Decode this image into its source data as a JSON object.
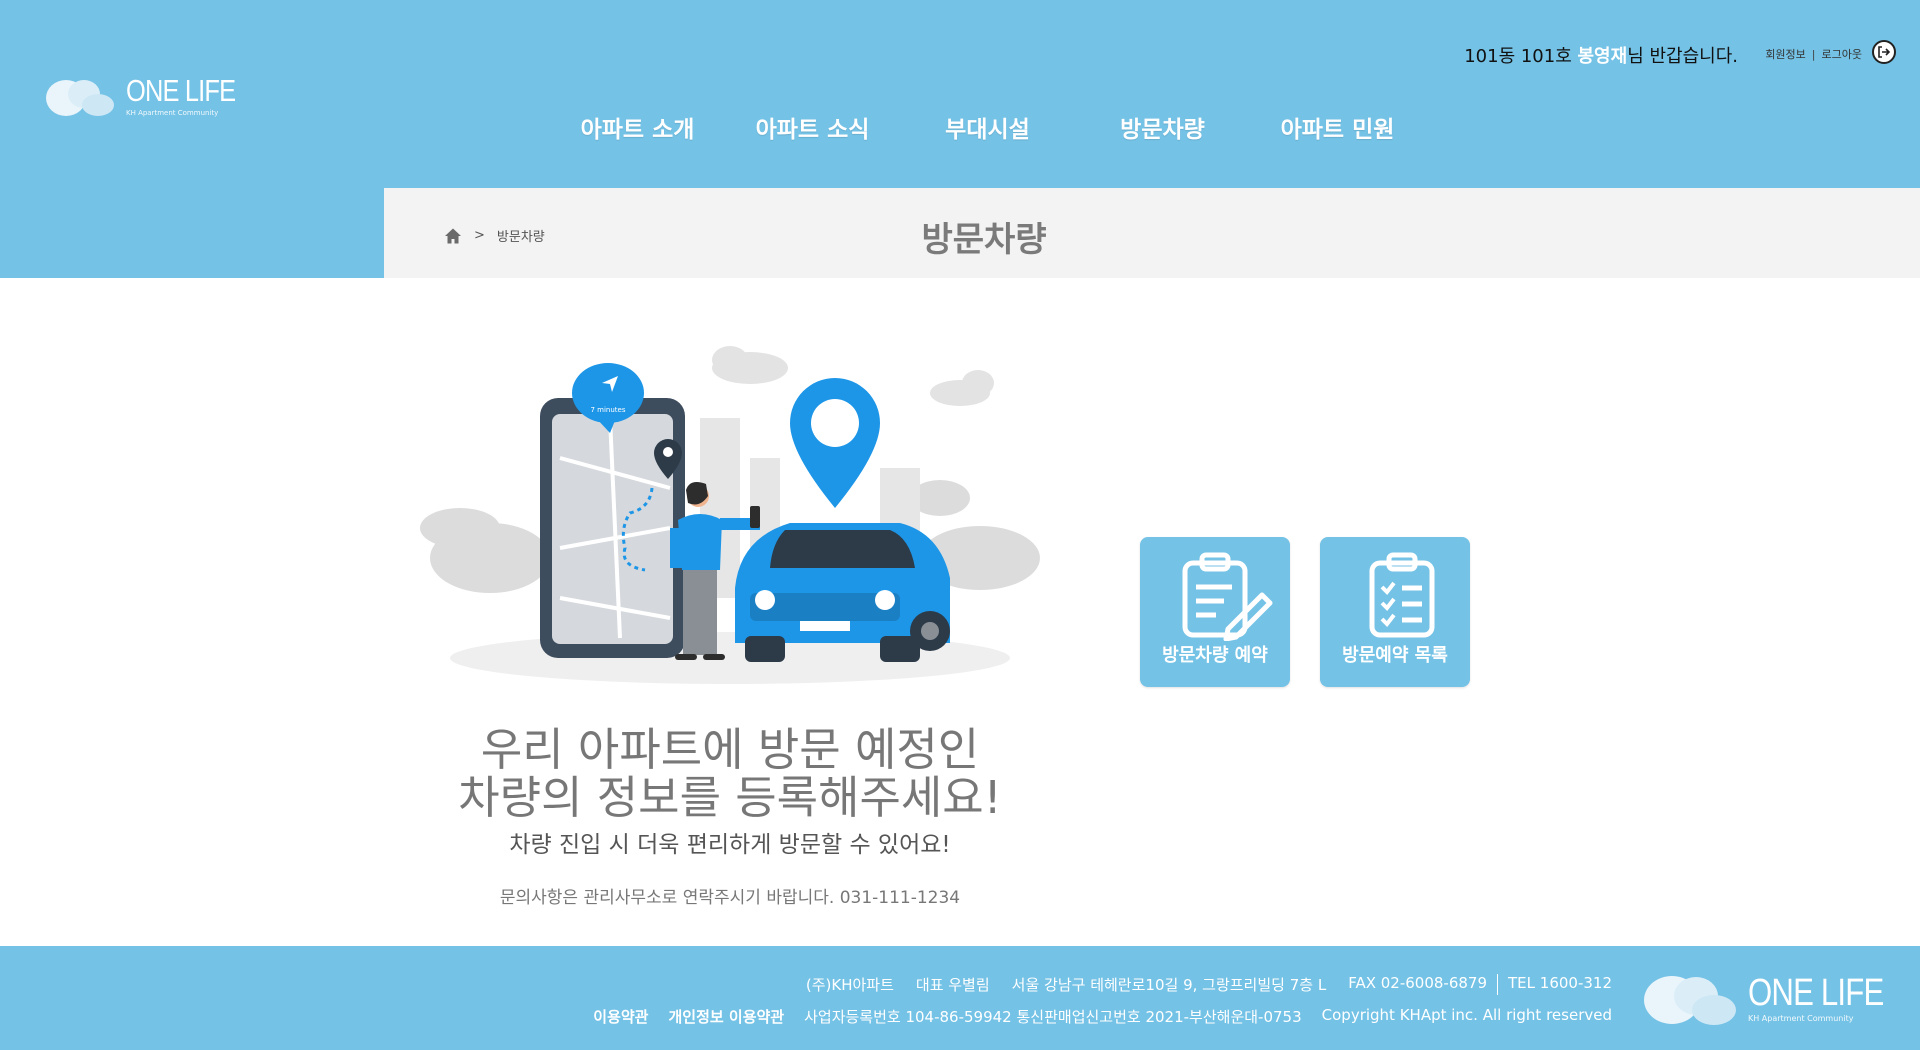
{
  "brand": {
    "name": "ONE LIFE",
    "tagline": "KH Apartment Community"
  },
  "header": {
    "greeting_prefix": "101동 101호 ",
    "greeting_name": "봉영재",
    "greeting_suffix": "님 반갑습니다.",
    "member_info": "회원정보",
    "logout": "로그아웃"
  },
  "nav": {
    "items": [
      {
        "label": "아파트 소개"
      },
      {
        "label": "아파트 소식"
      },
      {
        "label": "부대시설"
      },
      {
        "label": "방문차량"
      },
      {
        "label": "아파트 민원"
      }
    ]
  },
  "breadcrumb": {
    "separator": ">",
    "current": "방문차량"
  },
  "page": {
    "title": "방문차량",
    "headline_line1": "우리 아파트에 방문 예정인",
    "headline_line2": "차량의 정보를 등록해주세요!",
    "subline": "차량 진입 시 더욱 편리하게 방문할 수 있어요!",
    "contact": "문의사항은 관리사무소로 연락주시기 바랍니다. 031-111-1234"
  },
  "illustration": {
    "bubble_text": "7 minutes"
  },
  "actions": {
    "reserve": "방문차량 예약",
    "list": "방문예약 목록"
  },
  "footer": {
    "company": "(주)KH아파트",
    "ceo": "대표 우별림",
    "address": "서울 강남구 테헤란로10길 9, 그랑프리빌딩 7층 L",
    "fax": "FAX 02-6008-6879",
    "tel": "TEL 1600-312",
    "terms": "이용약관",
    "privacy": "개인정보 이용약관",
    "registration": "사업자등록번호 104-86-59942 통신판매업신고번호 2021-부산해운대-0753",
    "copyright": "Copyright KHApt inc. All right reserved"
  },
  "colors": {
    "primary": "#74c2e6",
    "title_bar": "#f3f3f4",
    "accent_blue": "#1d96e8"
  }
}
